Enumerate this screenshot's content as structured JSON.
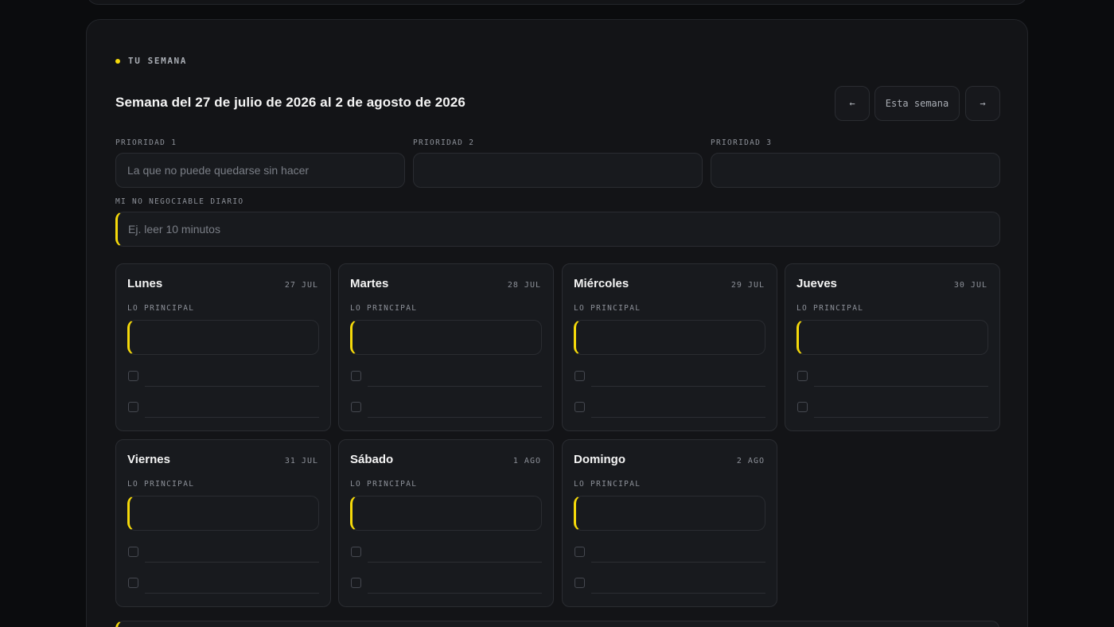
{
  "section_tag": "TU SEMANA",
  "week_title": "Semana del 27 de julio de 2026 al 2 de agosto de 2026",
  "nav": {
    "prev_label": "←",
    "this_week_label": "Esta semana",
    "next_label": "→"
  },
  "priorities": [
    {
      "label": "PRIORIDAD 1",
      "placeholder": "La que no puede quedarse sin hacer",
      "value": ""
    },
    {
      "label": "PRIORIDAD 2",
      "placeholder": "",
      "value": ""
    },
    {
      "label": "PRIORIDAD 3",
      "placeholder": "",
      "value": ""
    }
  ],
  "non_negotiable": {
    "label": "MI NO NEGOCIABLE DIARIO",
    "placeholder": "Ej. leer 10 minutos",
    "value": ""
  },
  "main_label": "LO PRINCIPAL",
  "days": [
    {
      "name": "Lunes",
      "date": "27 JUL"
    },
    {
      "name": "Martes",
      "date": "28 JUL"
    },
    {
      "name": "Miércoles",
      "date": "29 JUL"
    },
    {
      "name": "Jueves",
      "date": "30 JUL"
    },
    {
      "name": "Viernes",
      "date": "31 JUL"
    },
    {
      "name": "Sábado",
      "date": "1 AGO"
    },
    {
      "name": "Domingo",
      "date": "2 AGO"
    }
  ],
  "colors": {
    "accent": "#f5d90a",
    "background": "#0b0c0e",
    "card": "#131417"
  }
}
